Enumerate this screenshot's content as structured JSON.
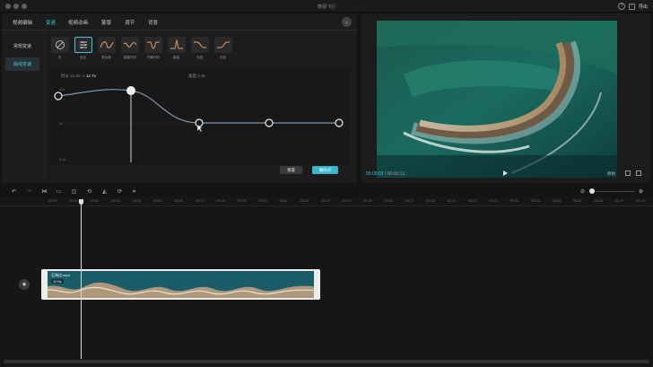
{
  "window": {
    "title": "微视飞行",
    "export_label": "导出",
    "help_icon": "question-icon",
    "export_icon": "export-icon"
  },
  "edit_panel": {
    "tabs": [
      {
        "label": "视频编辑",
        "active": false
      },
      {
        "label": "变速",
        "active": true
      },
      {
        "label": "视频动画",
        "active": false
      },
      {
        "label": "蒙版",
        "active": false
      },
      {
        "label": "调节",
        "active": false
      },
      {
        "label": "背景",
        "active": false
      }
    ],
    "speed_modes": [
      {
        "label": "常规变速",
        "active": false
      },
      {
        "label": "曲线变速",
        "active": true
      }
    ],
    "presets": [
      {
        "label": "无",
        "icon": "none-icon",
        "active": false
      },
      {
        "label": "自定",
        "icon": "custom-curve-icon",
        "active": true
      },
      {
        "label": "蒙太奇",
        "icon": "montage-curve-icon",
        "active": false
      },
      {
        "label": "英雄时刻",
        "icon": "hero-curve-icon",
        "active": false
      },
      {
        "label": "子弹时间",
        "icon": "bullet-time-curve-icon",
        "active": false
      },
      {
        "label": "跳接",
        "icon": "jump-cut-curve-icon",
        "active": false
      },
      {
        "label": "闪进",
        "icon": "flash-in-curve-icon",
        "active": false
      },
      {
        "label": "闪出",
        "icon": "flash-out-curve-icon",
        "active": false
      }
    ],
    "curve": {
      "duration_label": "时长 21.3s ->",
      "duration_value": "12.7s",
      "speed_label": "速度",
      "speed_value": "0.3x",
      "y_labels": [
        "10x",
        "1x",
        "0.1x"
      ],
      "reset_label": "重置",
      "delete_point_label": "删除点",
      "accent": "#3ec6dc"
    }
  },
  "player": {
    "current_time": "00:00:03",
    "separator": "/",
    "total_time": "00:00:13",
    "ratio_label": "原始"
  },
  "timeline": {
    "ruler_labels": [
      "00:00",
      "00:01",
      "00:02",
      "00:03",
      "00:04",
      "00:05",
      "00:06",
      "00:07",
      "00:08",
      "00:09",
      "00:10",
      "00:11",
      "00:12",
      "00:13",
      "00:14",
      "00:15",
      "00:16",
      "00:17",
      "00:18",
      "00:19",
      "00:20",
      "00:21",
      "00:22",
      "00:23",
      "00:24",
      "00:25",
      "00:26",
      "00:27",
      "00:28"
    ],
    "clip": {
      "name": "石海边.mp4",
      "speed_badge": "12.6s"
    },
    "cover_icon": "cover-icon"
  },
  "toolbar": {
    "tools": [
      "undo-icon",
      "redo-icon",
      "split-icon",
      "delete-icon",
      "freeze-icon",
      "reverse-icon",
      "mirror-icon",
      "rotate-icon",
      "crop-icon"
    ],
    "zoom_out_icon": "zoom-out-icon",
    "zoom_in_icon": "zoom-in-icon"
  }
}
